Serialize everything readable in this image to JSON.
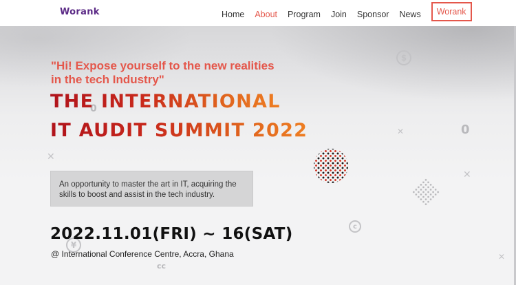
{
  "nav": {
    "brand": "Worank",
    "items": [
      {
        "label": "Home",
        "state": "normal"
      },
      {
        "label": "About",
        "state": "active"
      },
      {
        "label": "Program",
        "state": "normal"
      },
      {
        "label": "Join",
        "state": "normal"
      },
      {
        "label": "Sponsor",
        "state": "normal"
      },
      {
        "label": "News",
        "state": "normal"
      },
      {
        "label": "Worank",
        "state": "boxed"
      }
    ]
  },
  "hero": {
    "tagline_line1": "\"Hi! Expose yourself to the new realities",
    "tagline_line2": "in the tech Industry\"",
    "title_line1": "THE INTERNATIONAL",
    "title_line2": "IT AUDIT SUMMIT 2022",
    "description_line1": "An opportunity to master the art in IT, acquiring the",
    "description_line2": "skills to boost and assist in the tech industry.",
    "date": "2022.11.01(FRI) ~ 16(SAT)",
    "venue": "@ International Conference Centre, Accra, Ghana"
  },
  "decorations": {
    "icons": [
      "dollar-coin-icon",
      "zero-glyph-icon",
      "cent-coin-icon",
      "yen-coin-icon",
      "cross-mark-icon",
      "dotted-circle-pattern",
      "diamond-dot-pattern"
    ]
  },
  "colors": {
    "accent": "#e4574b",
    "brand": "#5b2a86",
    "title_gradient_start": "#b0131b",
    "title_gradient_end": "#ee7e22"
  }
}
